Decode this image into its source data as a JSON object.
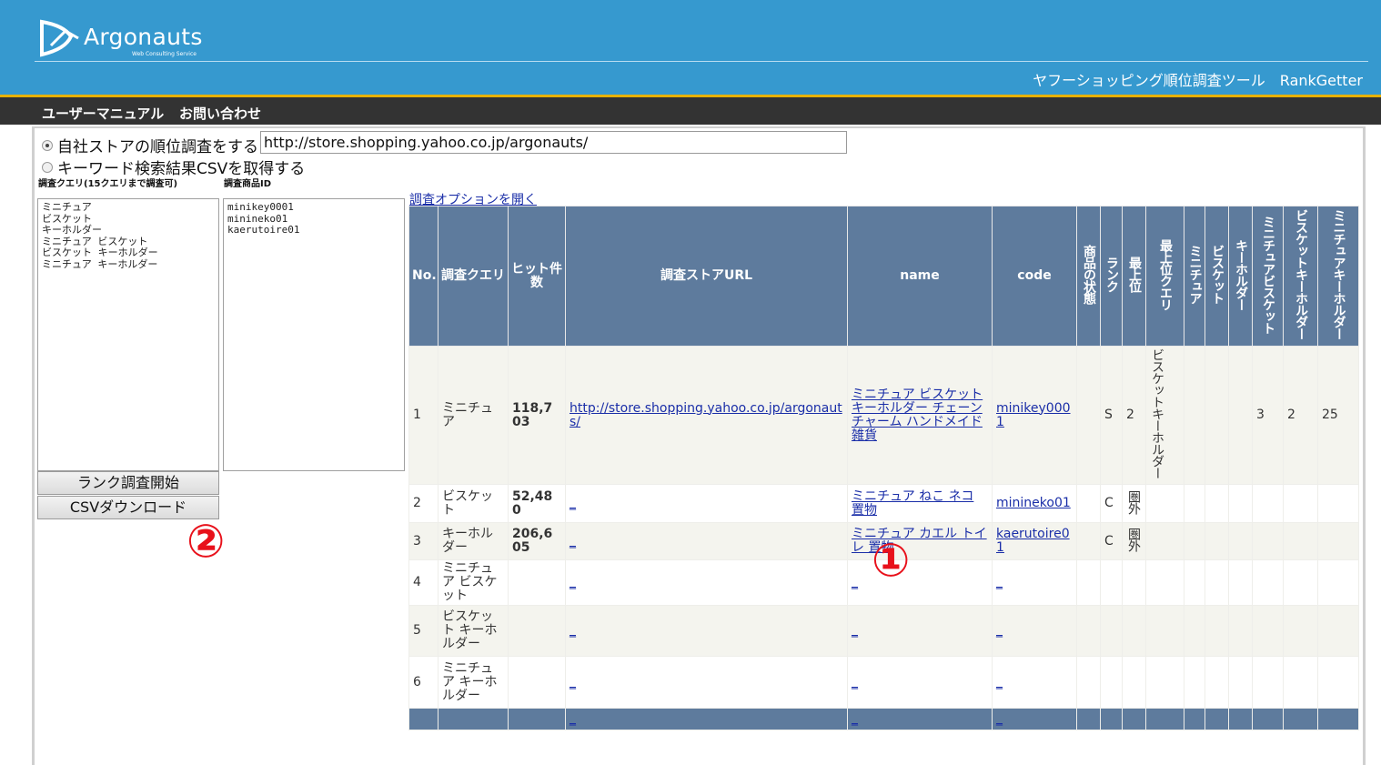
{
  "header": {
    "logo_text": "Argonauts",
    "logo_sub": "Web Consulting Service",
    "app_title": "ヤフーショッピング順位調査ツール　RankGetter"
  },
  "nav": {
    "items": [
      "ユーザーマニュアル",
      "お問い合わせ"
    ]
  },
  "form": {
    "radio_own_store": "自社ストアの順位調査をする",
    "radio_keyword_csv": "キーワード検索結果CSVを取得する",
    "store_url": "http://store.shopping.yahoo.co.jp/argonauts/",
    "query_label": "調査クエリ(15クエリまで調査可)",
    "item_id_label": "調査商品ID",
    "queries_text": "ミニチュア\nビスケット\nキーホルダー\nミニチュア ビスケット\nビスケット キーホルダー\nミニチュア キーホルダー",
    "item_ids_text": "minikey0001\nminineko01\nkaerutoire01",
    "start_button": "ランク調査開始",
    "csv_button": "CSVダウンロード",
    "marker_2": "②"
  },
  "results": {
    "options_link": "調査オプションを開く",
    "marker_1": "①",
    "headers": {
      "no": "No.",
      "query": "調査クエリ",
      "hits": "ヒット件数",
      "store_url": "調査ストアURL",
      "name": "name",
      "code": "code",
      "status": "商品の状態",
      "rank": "ランク",
      "top": "最上位",
      "top_query": "最上位クエリ",
      "q1": "ミニチュア",
      "q2": "ビスケット",
      "q3": "キーホルダー",
      "q4": "ミニチュアビスケット",
      "q5": "ビスケットキーホルダー",
      "q6": "ミニチュアキーホルダー"
    },
    "rows": [
      {
        "no": "1",
        "query": "ミニチュア",
        "hits": "118,703",
        "url": "http://store.shopping.yahoo.co.jp/argonauts/",
        "name": "ミニチュア ビスケット キーホルダー チェーン チャーム ハンドメイド 雑貨",
        "code": "minikey0001",
        "status": "",
        "rank": "S",
        "top": "2",
        "top_query": "ビスケットキーホルダー",
        "q1": "",
        "q2": "",
        "q3": "",
        "q4": "3",
        "q5": "2",
        "q6": "25"
      },
      {
        "no": "2",
        "query": "ビスケット",
        "hits": "52,480",
        "url": "_",
        "name": "ミニチュア ねこ ネコ 置物",
        "code": "minineko01",
        "status": "",
        "rank": "C",
        "top": "圏外",
        "top_query": "",
        "q1": "",
        "q2": "",
        "q3": "",
        "q4": "",
        "q5": "",
        "q6": ""
      },
      {
        "no": "3",
        "query": "キーホルダー",
        "hits": "206,605",
        "url": "_",
        "name": "ミニチュア カエル トイレ 置物",
        "code": "kaerutoire01",
        "status": "",
        "rank": "C",
        "top": "圏外",
        "top_query": "",
        "q1": "",
        "q2": "",
        "q3": "",
        "q4": "",
        "q5": "",
        "q6": ""
      },
      {
        "no": "4",
        "query": "ミニチュア ビスケット",
        "hits": "",
        "url": "_",
        "name": "_",
        "code": "_",
        "status": "",
        "rank": "",
        "top": "",
        "top_query": "",
        "q1": "",
        "q2": "",
        "q3": "",
        "q4": "",
        "q5": "",
        "q6": ""
      },
      {
        "no": "5",
        "query": "ビスケット キーホルダー",
        "hits": "",
        "url": "_",
        "name": "_",
        "code": "_",
        "status": "",
        "rank": "",
        "top": "",
        "top_query": "",
        "q1": "",
        "q2": "",
        "q3": "",
        "q4": "",
        "q5": "",
        "q6": ""
      },
      {
        "no": "6",
        "query": "ミニチュア キーホルダー",
        "hits": "",
        "url": "_",
        "name": "_",
        "code": "_",
        "status": "",
        "rank": "",
        "top": "",
        "top_query": "",
        "q1": "",
        "q2": "",
        "q3": "",
        "q4": "",
        "q5": "",
        "q6": ""
      }
    ],
    "footer": {
      "url": "_",
      "name": "_",
      "code": "_"
    }
  }
}
